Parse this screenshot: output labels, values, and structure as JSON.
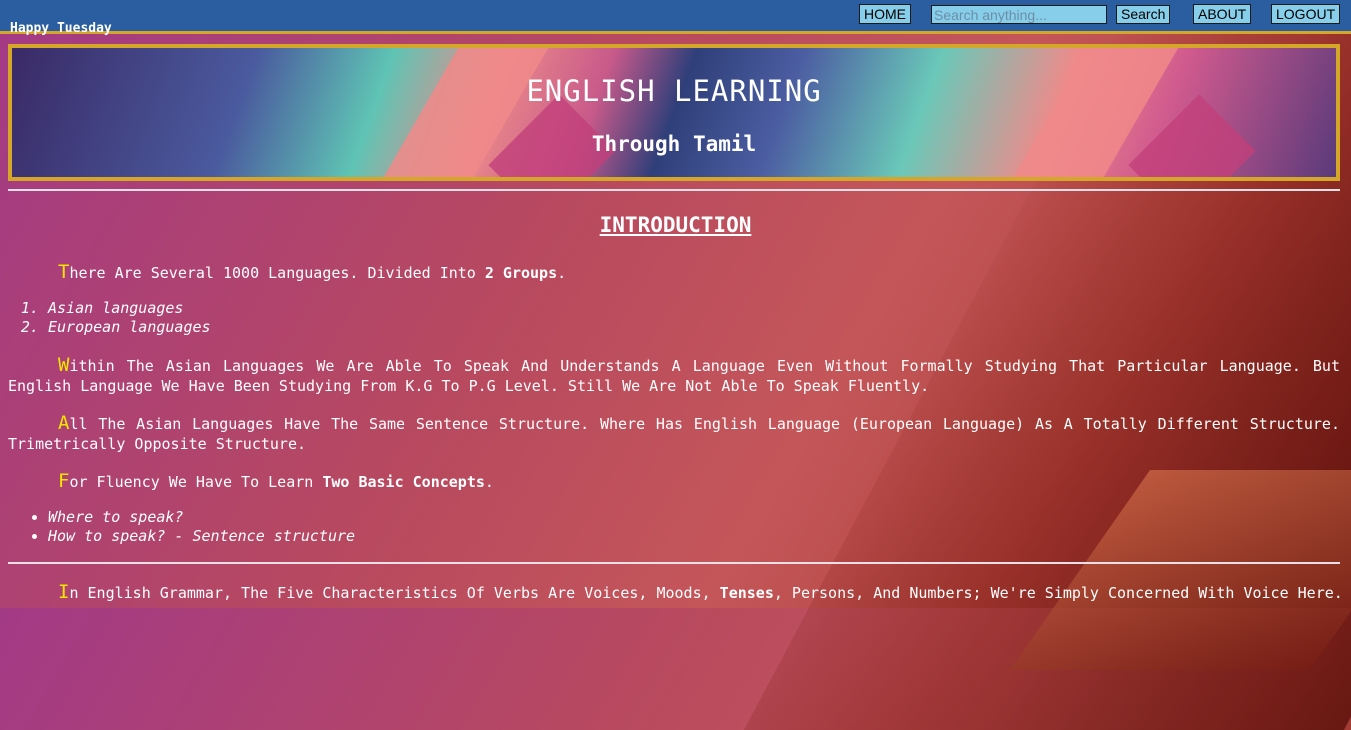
{
  "greeting": "Happy Tuesday",
  "nav": {
    "home": "HOME",
    "search_placeholder": "Search anything...",
    "search_button": "Search",
    "about": "ABOUT",
    "logout": "LOGOUT"
  },
  "banner": {
    "title": "ENGLISH LEARNING",
    "subtitle": "Through Tamil"
  },
  "content": {
    "heading": "INTRODUCTION",
    "p1": {
      "cap": "T",
      "text": "here Are Several 1000 Languages. Divided Into ",
      "bold": "2 Groups",
      "end": "."
    },
    "groups": [
      "Asian languages",
      "European languages"
    ],
    "p2": {
      "cap": "W",
      "text": "ithin The Asian Languages We Are Able To Speak And Understands A Language Even Without Formally Studying That Particular Language. But English Language We Have Been Studying From K.G To P.G Level. Still We Are Not Able To Speak Fluently."
    },
    "p3": {
      "cap": "A",
      "text": "ll The Asian Languages Have The Same Sentence Structure. Where Has English Language (European Language) As A Totally Different Structure. Trimetrically Opposite Structure."
    },
    "p4": {
      "cap": "F",
      "text": "or Fluency We Have To Learn ",
      "bold": "Two Basic Concepts",
      "end": "."
    },
    "concepts": [
      "Where to speak?",
      "How to speak? - Sentence structure"
    ],
    "p5": {
      "cap": "I",
      "text": "n English Grammar, The Five Characteristics Of Verbs Are Voices, Moods, ",
      "bold": "Tenses",
      "end": ", Persons, And Numbers; We're Simply Concerned With Voice Here."
    }
  },
  "colors": {
    "topbar": "#2a5ea0",
    "accent_border": "#d4a62a",
    "button_bg": "#87ceeb",
    "drop_cap": "#f2e600"
  }
}
